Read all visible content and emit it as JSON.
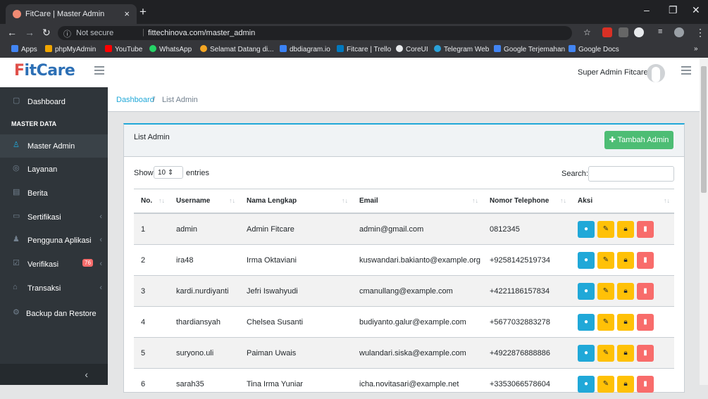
{
  "browser": {
    "tab_title": "FitCare | Master Admin",
    "tab_close": "×",
    "new_tab": "+",
    "not_secure": "Not secure",
    "url": "fittechinova.com/master_admin",
    "bookmarks": [
      "Apps",
      "phpMyAdmin",
      "YouTube",
      "WhatsApp",
      "Selamat Datang di...",
      "dbdiagram.io",
      "Fitcare | Trello",
      "CoreUI",
      "Telegram Web",
      "Google Terjemahan",
      "Google Docs"
    ],
    "more": "»"
  },
  "header": {
    "logo_f": "F",
    "logo_rest": "itCare",
    "user_name": "Super Admin Fitcare"
  },
  "sidebar": {
    "section_title": "MASTER DATA",
    "items": [
      {
        "label": "Dashboard",
        "icon": "monitor-icon"
      },
      {
        "label": "Master Admin",
        "icon": "user-icon"
      },
      {
        "label": "Layanan",
        "icon": "layers-icon"
      },
      {
        "label": "Berita",
        "icon": "news-icon"
      },
      {
        "label": "Sertifikasi",
        "icon": "certificate-icon"
      },
      {
        "label": "Pengguna Aplikasi",
        "icon": "users-icon"
      },
      {
        "label": "Verifikasi",
        "icon": "check-icon",
        "badge": "76"
      },
      {
        "label": "Transaksi",
        "icon": "bank-icon"
      },
      {
        "label": "Backup dan Restore",
        "icon": "gear-icon"
      }
    ],
    "minimize": "‹"
  },
  "breadcrumb": {
    "home": "Dashboard",
    "sep": "/",
    "current": "List Admin"
  },
  "card": {
    "title": "List Admin",
    "add_button": "Tambah Admin",
    "show": "Show",
    "entries_value": "10",
    "entries": "entries",
    "search_label": "Search:"
  },
  "table": {
    "headers": [
      "No.",
      "Username",
      "Nama Lengkap",
      "Email",
      "Nomor Telephone",
      "Aksi"
    ],
    "rows": [
      {
        "no": "1",
        "username": "admin",
        "nama": "Admin Fitcare",
        "email": "admin@gmail.com",
        "phone": "0812345"
      },
      {
        "no": "2",
        "username": "ira48",
        "nama": "Irma Oktaviani",
        "email": "kuswandari.bakianto@example.org",
        "phone": "+9258142519734"
      },
      {
        "no": "3",
        "username": "kardi.nurdiyanti",
        "nama": "Jefri Iswahyudi",
        "email": "cmanullang@example.com",
        "phone": "+4221186157834"
      },
      {
        "no": "4",
        "username": "thardiansyah",
        "nama": "Chelsea Susanti",
        "email": "budiyanto.galur@example.com",
        "phone": "+5677032883278"
      },
      {
        "no": "5",
        "username": "suryono.uli",
        "nama": "Paiman Uwais",
        "email": "wulandari.siska@example.com",
        "phone": "+4922876888886"
      },
      {
        "no": "6",
        "username": "sarah35",
        "nama": "Tina Irma Yuniar",
        "email": "icha.novitasari@example.net",
        "phone": "+3353066578604"
      }
    ]
  },
  "colors": {
    "primary": "#20a8d8",
    "success": "#4dbd74",
    "warning": "#ffc107",
    "danger": "#f86c6b",
    "sidebar": "#2f353a"
  }
}
